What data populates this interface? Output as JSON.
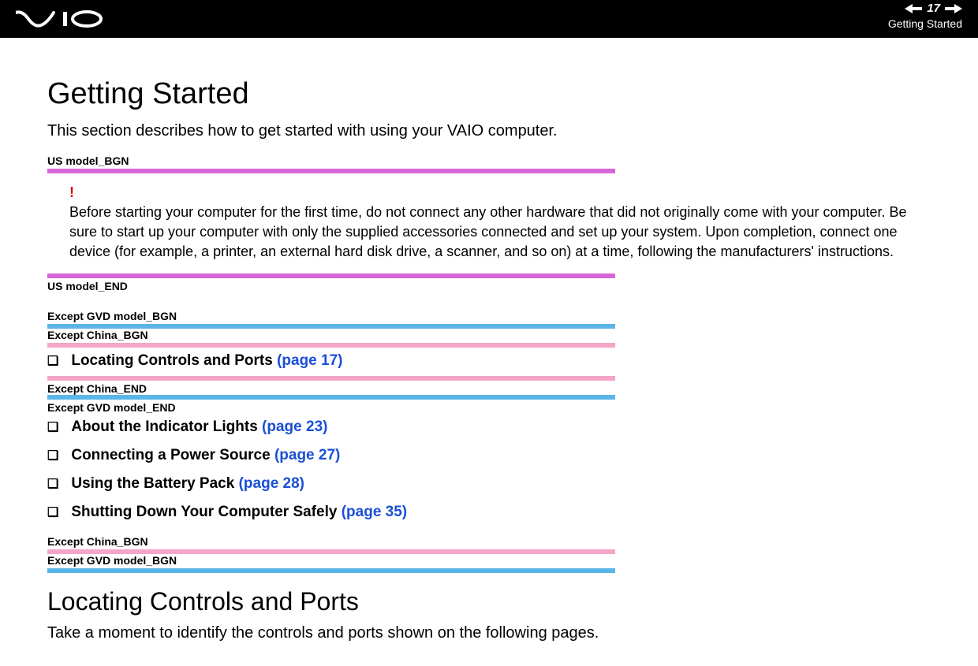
{
  "header": {
    "page_number": "17",
    "breadcrumb": "Getting Started"
  },
  "title": "Getting Started",
  "intro": "This section describes how to get started with using your VAIO computer.",
  "markers": {
    "us_bgn": "US model_BGN",
    "us_end": "US model_END",
    "except_gvd_bgn": "Except GVD model_BGN",
    "except_china_bgn": "Except China_BGN",
    "except_china_end": "Except China_END",
    "except_gvd_end": "Except GVD model_END",
    "except_china_bgn2": "Except China_BGN",
    "except_gvd_bgn2": "Except GVD model_BGN"
  },
  "warning": {
    "symbol": "!",
    "body": "Before starting your computer for the first time, do not connect any other hardware that did not originally come with your computer. Be sure to start up your computer with only the supplied accessories connected and set up your system. Upon completion, connect one device (for example, a printer, an external hard disk drive, a scanner, and so on) at a time, following the manufacturers' instructions."
  },
  "toc": [
    {
      "text": "Locating Controls and Ports ",
      "link": "(page 17)"
    },
    {
      "text": "About the Indicator Lights ",
      "link": "(page 23)"
    },
    {
      "text": "Connecting a Power Source ",
      "link": "(page 27)"
    },
    {
      "text": "Using the Battery Pack ",
      "link": "(page 28)"
    },
    {
      "text": "Shutting Down Your Computer Safely ",
      "link": "(page 35)"
    }
  ],
  "subtitle": "Locating Controls and Ports",
  "subintro": "Take a moment to identify the controls and ports shown on the following pages."
}
